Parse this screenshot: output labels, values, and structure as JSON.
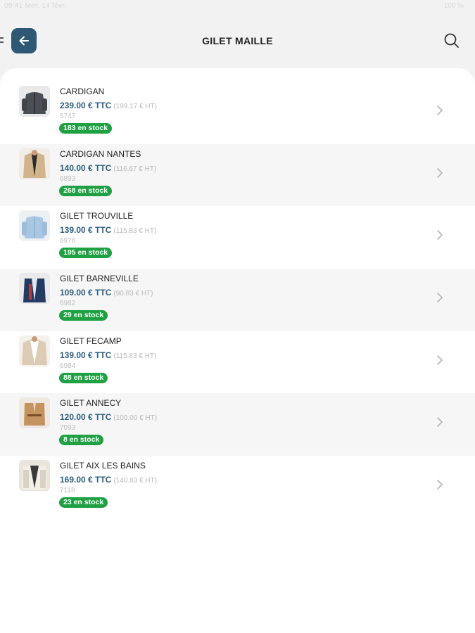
{
  "status_bar": {
    "left_text": "09:41 Mer. 14 févr.",
    "right_text": "100 %"
  },
  "header": {
    "title": "GILET MAILLE"
  },
  "colors": {
    "accent": "#2e5873",
    "price": "#2b5d7e",
    "stock_badge": "#1fa043",
    "row_alt": "#f6f6f6"
  },
  "icons": {
    "back": "arrow-left-icon",
    "search": "search-icon",
    "row": "chevron-right-icon",
    "menu": "menu-icon"
  },
  "products": [
    {
      "name": "CARDIGAN",
      "price_ttc": "239.00 € TTC",
      "price_ht": "(199.17 € HT)",
      "ref": "5747",
      "stock": "183 en stock",
      "thumb": "dark-gray"
    },
    {
      "name": "CARDIGAN NANTES",
      "price_ttc": "140.00 € TTC",
      "price_ht": "(116.67 € HT)",
      "ref": "6893",
      "stock": "268 en stock",
      "thumb": "beige"
    },
    {
      "name": "GILET TROUVILLE",
      "price_ttc": "139.00 € TTC",
      "price_ht": "(115.83 € HT)",
      "ref": "6976",
      "stock": "195 en stock",
      "thumb": "light-blue"
    },
    {
      "name": "GILET BARNEVILLE",
      "price_ttc": "109.00 € TTC",
      "price_ht": "(90.83 € HT)",
      "ref": "6982",
      "stock": "29 en stock",
      "thumb": "navy"
    },
    {
      "name": "GILET FECAMP",
      "price_ttc": "139.00 € TTC",
      "price_ht": "(115.83 € HT)",
      "ref": "6984",
      "stock": "88 en stock",
      "thumb": "oatmeal"
    },
    {
      "name": "GILET ANNECY",
      "price_ttc": "120.00 € TTC",
      "price_ht": "(100.00 € HT)",
      "ref": "7093",
      "stock": "8 en stock",
      "thumb": "camel"
    },
    {
      "name": "GILET AIX LES BAINS",
      "price_ttc": "169.00 € TTC",
      "price_ht": "(140.83 € HT)",
      "ref": "7118",
      "stock": "23 en stock",
      "thumb": "cream"
    }
  ]
}
